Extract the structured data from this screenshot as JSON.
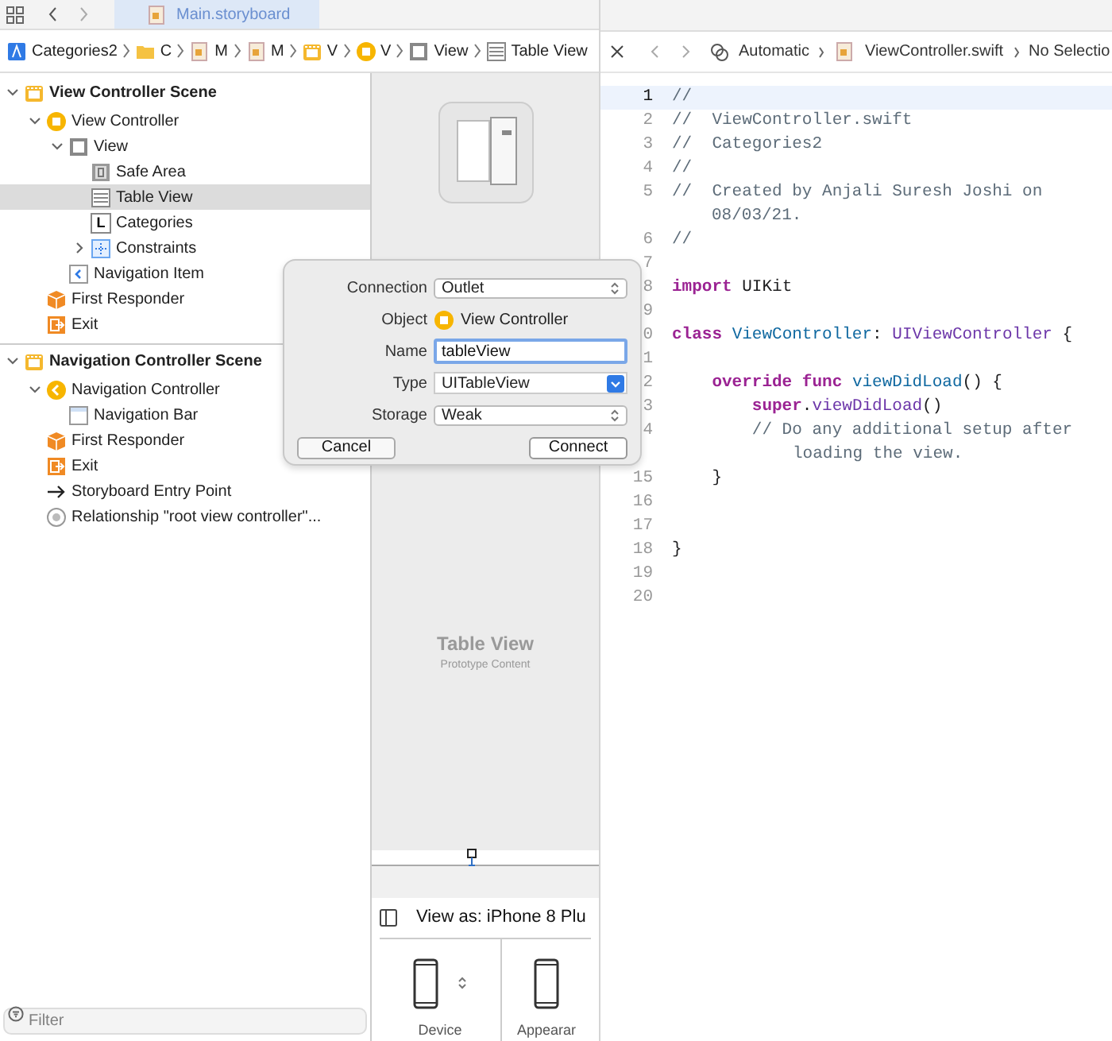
{
  "tab": {
    "label": "Main.storyboard",
    "selected": true
  },
  "breadcrumb": [
    {
      "label": "Categories2",
      "kind": "project"
    },
    {
      "label": "C",
      "kind": "folder"
    },
    {
      "label": "M",
      "kind": "file"
    },
    {
      "label": "M",
      "kind": "file"
    },
    {
      "label": "V",
      "kind": "scene"
    },
    {
      "label": "V",
      "kind": "vc"
    },
    {
      "label": "View",
      "kind": "view"
    },
    {
      "label": "Table View",
      "kind": "table"
    }
  ],
  "outline": [
    {
      "label": "View Controller Scene",
      "kind": "scene",
      "expanded": true,
      "selected": false,
      "children": [
        {
          "label": "View Controller",
          "kind": "vc",
          "expanded": true,
          "selected": false,
          "children": [
            {
              "label": "View",
              "kind": "view",
              "expanded": true,
              "selected": false,
              "children": [
                {
                  "label": "Safe Area",
                  "kind": "safe",
                  "selected": false
                },
                {
                  "label": "Table View",
                  "kind": "table",
                  "selected": true
                },
                {
                  "label": "Categories",
                  "kind": "label",
                  "badge": "L",
                  "selected": false
                },
                {
                  "label": "Constraints",
                  "kind": "constraints",
                  "expanded": false,
                  "selected": false
                }
              ]
            },
            {
              "label": "Navigation Item",
              "kind": "navitem",
              "selected": false
            }
          ]
        },
        {
          "label": "First Responder",
          "kind": "responder",
          "selected": false
        },
        {
          "label": "Exit",
          "kind": "exit",
          "selected": false
        }
      ]
    },
    {
      "label": "Navigation Controller Scene",
      "kind": "scene",
      "expanded": true,
      "selected": false,
      "children": [
        {
          "label": "Navigation Controller",
          "kind": "navvc",
          "expanded": true,
          "selected": false,
          "children": [
            {
              "label": "Navigation Bar",
              "kind": "navbar",
              "selected": false
            }
          ]
        },
        {
          "label": "First Responder",
          "kind": "responder",
          "selected": false
        },
        {
          "label": "Exit",
          "kind": "exit",
          "selected": false
        },
        {
          "label": "Storyboard Entry Point",
          "kind": "entry",
          "selected": false
        },
        {
          "label": "Relationship \"root view controller\"...",
          "kind": "relation",
          "selected": false
        }
      ]
    }
  ],
  "filter": {
    "placeholder": "Filter"
  },
  "canvas": {
    "title": "Table View",
    "subtitle": "Prototype Content",
    "view_as": "View as: iPhone 8 Plu",
    "options": [
      "Device",
      "Appearar"
    ]
  },
  "dialog": {
    "rows": [
      {
        "label": "Connection",
        "kind": "popup",
        "value": "Outlet"
      },
      {
        "label": "Object",
        "kind": "object",
        "value": "View Controller"
      },
      {
        "label": "Name",
        "kind": "input",
        "value": "tableView"
      },
      {
        "label": "Type",
        "kind": "combo",
        "value": "UITableView"
      },
      {
        "label": "Storage",
        "kind": "popup",
        "value": "Weak"
      }
    ],
    "buttons": [
      {
        "label": "Cancel",
        "kind": "cancel"
      },
      {
        "label": "Connect",
        "kind": "default"
      }
    ]
  },
  "jump_bar": [
    "Automatic",
    "ViewController.swift",
    "No Selectio"
  ],
  "code": [
    {
      "num": "1",
      "current": true,
      "parts": [
        {
          "t": "//",
          "kind": "comment"
        }
      ]
    },
    {
      "num": "2",
      "current": false,
      "parts": [
        {
          "t": "//  ViewController.swift",
          "kind": "comment"
        }
      ]
    },
    {
      "num": "3",
      "current": false,
      "parts": [
        {
          "t": "//  Categories2",
          "kind": "comment"
        }
      ]
    },
    {
      "num": "4",
      "current": false,
      "parts": [
        {
          "t": "//",
          "kind": "comment"
        }
      ]
    },
    {
      "num": "5",
      "current": false,
      "parts": [
        {
          "t": "//  Created by Anjali Suresh Joshi on",
          "kind": "comment"
        }
      ],
      "wrap": {
        "t": "08/03/21.",
        "kind": "comment"
      }
    },
    {
      "num": "6",
      "current": false,
      "parts": [
        {
          "t": "//",
          "kind": "comment"
        }
      ]
    },
    {
      "num": "7",
      "current": false
    },
    {
      "num": "8",
      "current": false,
      "parts": [
        {
          "t": "import",
          "kind": "keyword"
        },
        {
          "t": " UIKit",
          "kind": "plain"
        }
      ]
    },
    {
      "num": "9",
      "current": false
    },
    {
      "num": "0",
      "current": false,
      "parts": [
        {
          "t": "class",
          "kind": "keyword"
        },
        {
          "t": " ViewController",
          "kind": "decl"
        },
        {
          "t": ": ",
          "kind": "plain"
        },
        {
          "t": "UIViewController",
          "kind": "type"
        },
        {
          "t": " {",
          "kind": "plain"
        }
      ]
    },
    {
      "num": "1",
      "current": false
    },
    {
      "num": "2",
      "current": false,
      "parts": [
        {
          "t": "    override",
          "kind": "keyword"
        },
        {
          "t": " func",
          "kind": "keyword"
        },
        {
          "t": " viewDidLoad",
          "kind": "decl"
        },
        {
          "t": "() {",
          "kind": "plain"
        }
      ]
    },
    {
      "num": "3",
      "current": false,
      "parts": [
        {
          "t": "        super",
          "kind": "keyword"
        },
        {
          "t": ".",
          "kind": "plain"
        },
        {
          "t": "viewDidLoad",
          "kind": "type"
        },
        {
          "t": "()",
          "kind": "plain"
        }
      ]
    },
    {
      "num": "4",
      "current": false,
      "parts": [
        {
          "t": "        // Do any additional setup after",
          "kind": "comment"
        }
      ],
      "wrap": {
        "t": "loading the view.",
        "kind": "comment"
      }
    },
    {
      "num": "15",
      "current": false,
      "parts": [
        {
          "t": "    }",
          "kind": "plain"
        }
      ]
    },
    {
      "num": "16",
      "current": false
    },
    {
      "num": "17",
      "current": false
    },
    {
      "num": "18",
      "current": false,
      "parts": [
        {
          "t": "}",
          "kind": "plain"
        }
      ]
    },
    {
      "num": "19",
      "current": false
    },
    {
      "num": "20",
      "current": false
    }
  ]
}
